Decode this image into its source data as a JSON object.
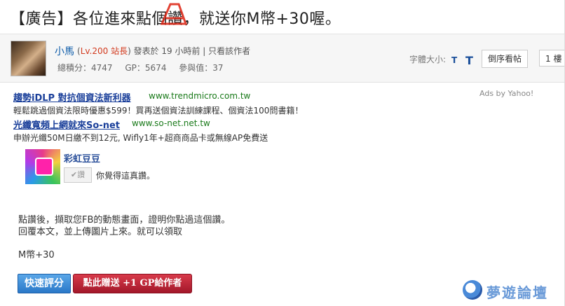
{
  "post": {
    "title": "【廣告】各位進來點個讚，就送你M幣+30喔。"
  },
  "author": {
    "name": "小馬",
    "level": "Lv.200 站長",
    "posted": "發表於 19 小時前",
    "only_view": "只看該作者",
    "stats": [
      "總積分：4747",
      "GP：5674",
      "參與值：37"
    ]
  },
  "toolbar": {
    "font_size_label": "字體大小:",
    "font_small": "T",
    "font_large": "T",
    "reverse_label": "倒序看帖",
    "floor_label": "1 樓"
  },
  "ads": {
    "by": "Ads by Yahoo!",
    "items": [
      {
        "title": "趨勢iDLP 對抗個資法新利器",
        "url": "www.trendmicro.com.tw",
        "desc": "輕鬆跳過個資法限時優惠$599！買再送個資法訓練課程、個資法100問書籍！"
      },
      {
        "title": "光纖寬頻上網就來So-net",
        "url": "www.so-net.net.tw",
        "desc": "申辦光纖50M日繳不到12元, Wifly1年+超商商品卡或無線AP免費送"
      }
    ]
  },
  "fb_widget": {
    "page_name": "彩虹豆豆",
    "like_label": "✔讚",
    "like_text": "你覺得這真讚。"
  },
  "content": {
    "line1": "點讚後，擷取您FB的動態畫面，證明你點過這個讚。",
    "line2": "回覆本文，並上傳圖片上來。就可以領取",
    "line3": "M幣+30"
  },
  "actions": {
    "quick_rate": "快速評分",
    "give_gp": "點此贈送 +1 GP給作者"
  },
  "watermark": {
    "text": "夢遊論壇"
  }
}
